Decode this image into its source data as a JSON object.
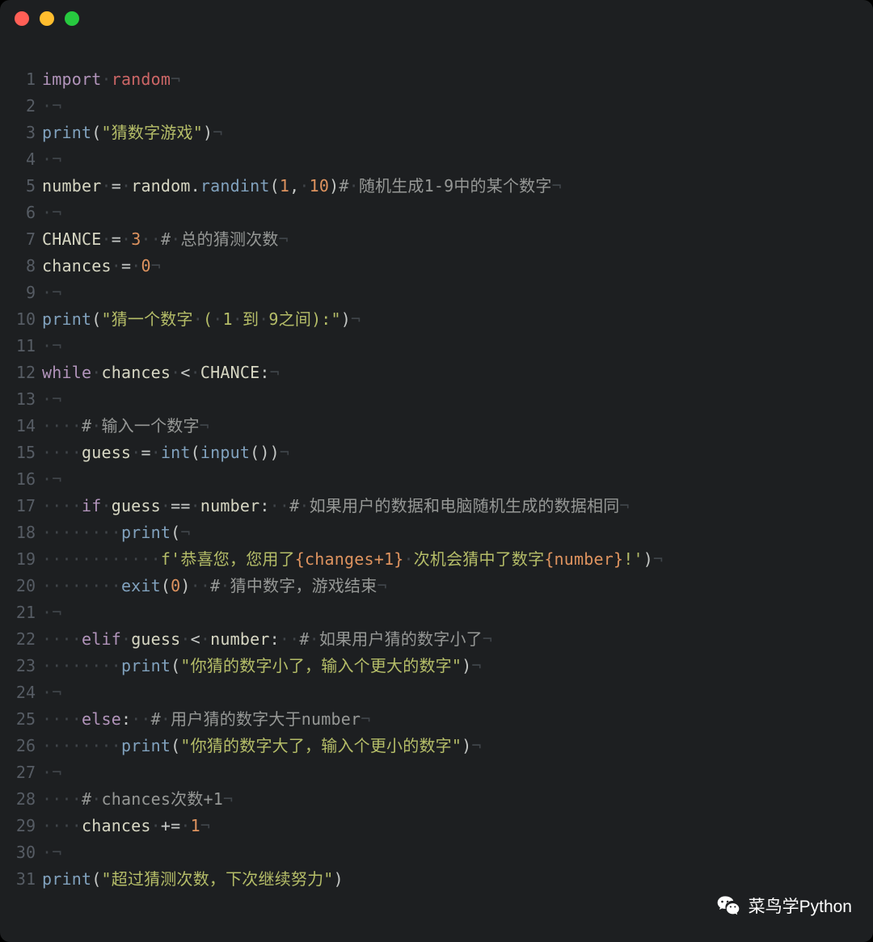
{
  "traffic_lights": [
    "red",
    "yellow",
    "green"
  ],
  "watermark_text": "菜鸟学Python",
  "lines": [
    {
      "n": 1,
      "tokens": [
        {
          "c": "kw",
          "t": "import"
        },
        {
          "c": "ws",
          "t": "·"
        },
        {
          "c": "name",
          "t": "random"
        },
        {
          "c": "ws",
          "t": "¬"
        }
      ]
    },
    {
      "n": 2,
      "tokens": [
        {
          "c": "ws",
          "t": "·¬"
        }
      ]
    },
    {
      "n": 3,
      "tokens": [
        {
          "c": "call",
          "t": "print"
        },
        {
          "c": "op",
          "t": "("
        },
        {
          "c": "str",
          "t": "\"猜数字游戏\""
        },
        {
          "c": "op",
          "t": ")"
        },
        {
          "c": "ws",
          "t": "¬"
        }
      ]
    },
    {
      "n": 4,
      "tokens": [
        {
          "c": "ws",
          "t": "·¬"
        }
      ]
    },
    {
      "n": 5,
      "tokens": [
        {
          "c": "fn",
          "t": "number"
        },
        {
          "c": "ws",
          "t": "·"
        },
        {
          "c": "op",
          "t": "="
        },
        {
          "c": "ws",
          "t": "·"
        },
        {
          "c": "fn",
          "t": "random"
        },
        {
          "c": "op",
          "t": "."
        },
        {
          "c": "call",
          "t": "randint"
        },
        {
          "c": "op",
          "t": "("
        },
        {
          "c": "num",
          "t": "1"
        },
        {
          "c": "op",
          "t": ","
        },
        {
          "c": "ws",
          "t": "·"
        },
        {
          "c": "num",
          "t": "10"
        },
        {
          "c": "op",
          "t": ")"
        },
        {
          "c": "cmt",
          "t": "#"
        },
        {
          "c": "ws",
          "t": "·"
        },
        {
          "c": "cmt",
          "t": "随机生成1-9中的某个数字"
        },
        {
          "c": "ws",
          "t": "¬"
        }
      ]
    },
    {
      "n": 6,
      "tokens": [
        {
          "c": "ws",
          "t": "·¬"
        }
      ]
    },
    {
      "n": 7,
      "tokens": [
        {
          "c": "fn",
          "t": "CHANCE"
        },
        {
          "c": "ws",
          "t": "·"
        },
        {
          "c": "op",
          "t": "="
        },
        {
          "c": "ws",
          "t": "·"
        },
        {
          "c": "num",
          "t": "3"
        },
        {
          "c": "ws",
          "t": "··"
        },
        {
          "c": "cmt",
          "t": "#"
        },
        {
          "c": "ws",
          "t": "·"
        },
        {
          "c": "cmt",
          "t": "总的猜测次数"
        },
        {
          "c": "ws",
          "t": "¬"
        }
      ]
    },
    {
      "n": 8,
      "tokens": [
        {
          "c": "fn",
          "t": "chances"
        },
        {
          "c": "ws",
          "t": "·"
        },
        {
          "c": "op",
          "t": "="
        },
        {
          "c": "ws",
          "t": "·"
        },
        {
          "c": "num",
          "t": "0"
        },
        {
          "c": "ws",
          "t": "¬"
        }
      ]
    },
    {
      "n": 9,
      "tokens": [
        {
          "c": "ws",
          "t": "·¬"
        }
      ]
    },
    {
      "n": 10,
      "tokens": [
        {
          "c": "call",
          "t": "print"
        },
        {
          "c": "op",
          "t": "("
        },
        {
          "c": "str",
          "t": "\"猜一个数字"
        },
        {
          "c": "ws",
          "t": "·"
        },
        {
          "c": "str",
          "t": "("
        },
        {
          "c": "ws",
          "t": "·"
        },
        {
          "c": "str",
          "t": "1"
        },
        {
          "c": "ws",
          "t": "·"
        },
        {
          "c": "str",
          "t": "到"
        },
        {
          "c": "ws",
          "t": "·"
        },
        {
          "c": "str",
          "t": "9之间):\""
        },
        {
          "c": "op",
          "t": ")"
        },
        {
          "c": "ws",
          "t": "¬"
        }
      ]
    },
    {
      "n": 11,
      "tokens": [
        {
          "c": "ws",
          "t": "·¬"
        }
      ]
    },
    {
      "n": 12,
      "tokens": [
        {
          "c": "kw",
          "t": "while"
        },
        {
          "c": "ws",
          "t": "·"
        },
        {
          "c": "fn",
          "t": "chances"
        },
        {
          "c": "ws",
          "t": "·"
        },
        {
          "c": "op",
          "t": "<"
        },
        {
          "c": "ws",
          "t": "·"
        },
        {
          "c": "fn",
          "t": "CHANCE"
        },
        {
          "c": "op",
          "t": ":"
        },
        {
          "c": "ws",
          "t": "¬"
        }
      ]
    },
    {
      "n": 13,
      "tokens": [
        {
          "c": "ws",
          "t": "·¬"
        }
      ]
    },
    {
      "n": 14,
      "tokens": [
        {
          "c": "ws",
          "t": "····"
        },
        {
          "c": "cmt",
          "t": "#"
        },
        {
          "c": "ws",
          "t": "·"
        },
        {
          "c": "cmt",
          "t": "输入一个数字"
        },
        {
          "c": "ws",
          "t": "¬"
        }
      ]
    },
    {
      "n": 15,
      "tokens": [
        {
          "c": "ws",
          "t": "····"
        },
        {
          "c": "fn",
          "t": "guess"
        },
        {
          "c": "ws",
          "t": "·"
        },
        {
          "c": "op",
          "t": "="
        },
        {
          "c": "ws",
          "t": "·"
        },
        {
          "c": "call",
          "t": "int"
        },
        {
          "c": "op",
          "t": "("
        },
        {
          "c": "call",
          "t": "input"
        },
        {
          "c": "op",
          "t": "())"
        },
        {
          "c": "ws",
          "t": "¬"
        }
      ]
    },
    {
      "n": 16,
      "tokens": [
        {
          "c": "ws",
          "t": "·¬"
        }
      ]
    },
    {
      "n": 17,
      "tokens": [
        {
          "c": "ws",
          "t": "····"
        },
        {
          "c": "kw",
          "t": "if"
        },
        {
          "c": "ws",
          "t": "·"
        },
        {
          "c": "fn",
          "t": "guess"
        },
        {
          "c": "ws",
          "t": "·"
        },
        {
          "c": "op",
          "t": "=="
        },
        {
          "c": "ws",
          "t": "·"
        },
        {
          "c": "fn",
          "t": "number"
        },
        {
          "c": "op",
          "t": ":"
        },
        {
          "c": "ws",
          "t": "··"
        },
        {
          "c": "cmt",
          "t": "#"
        },
        {
          "c": "ws",
          "t": "·"
        },
        {
          "c": "cmt",
          "t": "如果用户的数据和电脑随机生成的数据相同"
        },
        {
          "c": "ws",
          "t": "¬"
        }
      ]
    },
    {
      "n": 18,
      "tokens": [
        {
          "c": "ws",
          "t": "········"
        },
        {
          "c": "call",
          "t": "print"
        },
        {
          "c": "op",
          "t": "("
        },
        {
          "c": "ws",
          "t": "¬"
        }
      ]
    },
    {
      "n": 19,
      "tokens": [
        {
          "c": "ws",
          "t": "············"
        },
        {
          "c": "fprefix",
          "t": "f'恭喜您，您用了"
        },
        {
          "c": "interp",
          "t": "{changes+1}"
        },
        {
          "c": "ws",
          "t": "·"
        },
        {
          "c": "str",
          "t": "次机会猜中了数字"
        },
        {
          "c": "interp",
          "t": "{number}"
        },
        {
          "c": "str",
          "t": "!'"
        },
        {
          "c": "op",
          "t": ")"
        },
        {
          "c": "ws",
          "t": "¬"
        }
      ]
    },
    {
      "n": 20,
      "tokens": [
        {
          "c": "ws",
          "t": "········"
        },
        {
          "c": "call",
          "t": "exit"
        },
        {
          "c": "op",
          "t": "("
        },
        {
          "c": "num",
          "t": "0"
        },
        {
          "c": "op",
          "t": ")"
        },
        {
          "c": "ws",
          "t": "··"
        },
        {
          "c": "cmt",
          "t": "#"
        },
        {
          "c": "ws",
          "t": "·"
        },
        {
          "c": "cmt",
          "t": "猜中数字，游戏结束"
        },
        {
          "c": "ws",
          "t": "¬"
        }
      ]
    },
    {
      "n": 21,
      "tokens": [
        {
          "c": "ws",
          "t": "·¬"
        }
      ]
    },
    {
      "n": 22,
      "tokens": [
        {
          "c": "ws",
          "t": "····"
        },
        {
          "c": "kw",
          "t": "elif"
        },
        {
          "c": "ws",
          "t": "·"
        },
        {
          "c": "fn",
          "t": "guess"
        },
        {
          "c": "ws",
          "t": "·"
        },
        {
          "c": "op",
          "t": "<"
        },
        {
          "c": "ws",
          "t": "·"
        },
        {
          "c": "fn",
          "t": "number"
        },
        {
          "c": "op",
          "t": ":"
        },
        {
          "c": "ws",
          "t": "··"
        },
        {
          "c": "cmt",
          "t": "#"
        },
        {
          "c": "ws",
          "t": "·"
        },
        {
          "c": "cmt",
          "t": "如果用户猜的数字小了"
        },
        {
          "c": "ws",
          "t": "¬"
        }
      ]
    },
    {
      "n": 23,
      "tokens": [
        {
          "c": "ws",
          "t": "········"
        },
        {
          "c": "call",
          "t": "print"
        },
        {
          "c": "op",
          "t": "("
        },
        {
          "c": "str",
          "t": "\"你猜的数字小了，输入个更大的数字\""
        },
        {
          "c": "op",
          "t": ")"
        },
        {
          "c": "ws",
          "t": "¬"
        }
      ]
    },
    {
      "n": 24,
      "tokens": [
        {
          "c": "ws",
          "t": "·¬"
        }
      ]
    },
    {
      "n": 25,
      "tokens": [
        {
          "c": "ws",
          "t": "····"
        },
        {
          "c": "kw",
          "t": "else"
        },
        {
          "c": "op",
          "t": ":"
        },
        {
          "c": "ws",
          "t": "··"
        },
        {
          "c": "cmt",
          "t": "#"
        },
        {
          "c": "ws",
          "t": "·"
        },
        {
          "c": "cmt",
          "t": "用户猜的数字大于number"
        },
        {
          "c": "ws",
          "t": "¬"
        }
      ]
    },
    {
      "n": 26,
      "tokens": [
        {
          "c": "ws",
          "t": "········"
        },
        {
          "c": "call",
          "t": "print"
        },
        {
          "c": "op",
          "t": "("
        },
        {
          "c": "str",
          "t": "\"你猜的数字大了，输入个更小的数字\""
        },
        {
          "c": "op",
          "t": ")"
        },
        {
          "c": "ws",
          "t": "¬"
        }
      ]
    },
    {
      "n": 27,
      "tokens": [
        {
          "c": "ws",
          "t": "·¬"
        }
      ]
    },
    {
      "n": 28,
      "tokens": [
        {
          "c": "ws",
          "t": "····"
        },
        {
          "c": "cmt",
          "t": "#"
        },
        {
          "c": "ws",
          "t": "·"
        },
        {
          "c": "cmt",
          "t": "chances次数+1"
        },
        {
          "c": "ws",
          "t": "¬"
        }
      ]
    },
    {
      "n": 29,
      "tokens": [
        {
          "c": "ws",
          "t": "····"
        },
        {
          "c": "fn",
          "t": "chances"
        },
        {
          "c": "ws",
          "t": "·"
        },
        {
          "c": "op",
          "t": "+="
        },
        {
          "c": "ws",
          "t": "·"
        },
        {
          "c": "num",
          "t": "1"
        },
        {
          "c": "ws",
          "t": "¬"
        }
      ]
    },
    {
      "n": 30,
      "tokens": [
        {
          "c": "ws",
          "t": "·¬"
        }
      ]
    },
    {
      "n": 31,
      "tokens": [
        {
          "c": "call",
          "t": "print"
        },
        {
          "c": "op",
          "t": "("
        },
        {
          "c": "str",
          "t": "\"超过猜测次数，下次继续努力\""
        },
        {
          "c": "op",
          "t": ")"
        }
      ]
    }
  ]
}
